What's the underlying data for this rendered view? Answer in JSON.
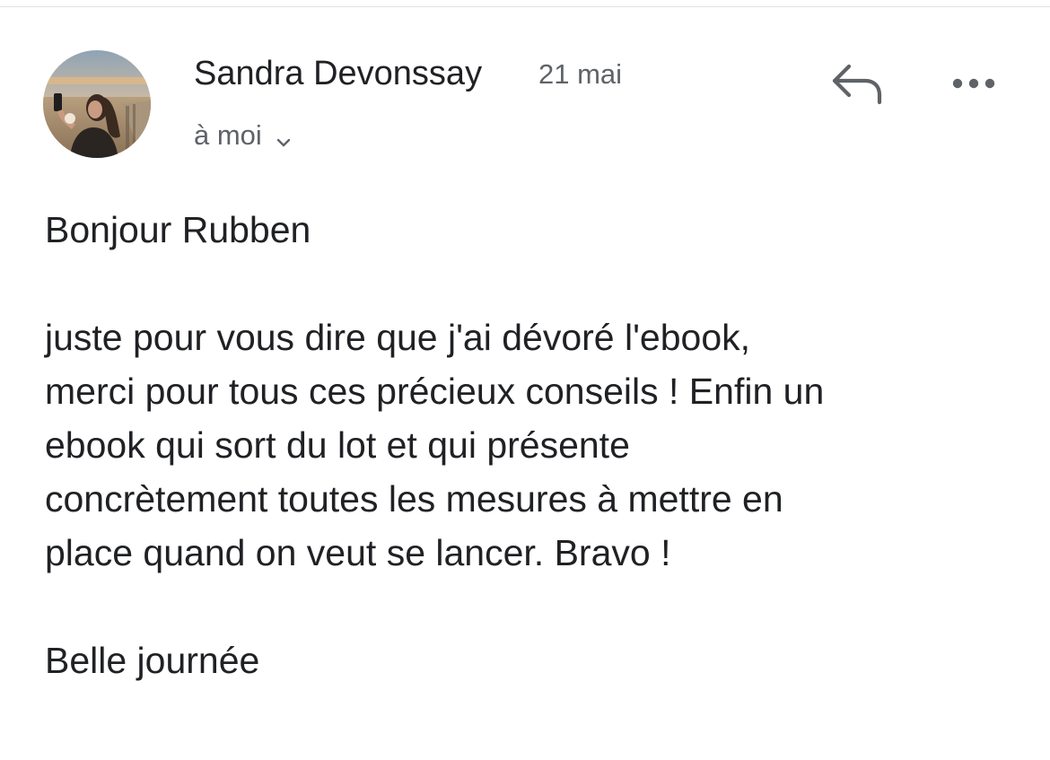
{
  "email": {
    "sender_name": "Sandra Devonssay",
    "date": "21 mai",
    "recipient": "à moi",
    "avatar_icon": "profile-photo",
    "reply_icon": "reply-arrow-icon",
    "more_icon": "more-horizontal-icon",
    "expand_icon": "chevron-down-icon"
  },
  "message": {
    "greeting": "Bonjour Rubben",
    "lines": [
      "juste pour vous dire que j'ai dévoré l'ebook,",
      "merci pour tous ces précieux conseils ! Enfin un",
      "ebook qui sort du lot et qui présente",
      "concrètement toutes les mesures à mettre en",
      "place quand on veut se lancer. Bravo !"
    ],
    "closing": "Belle journée"
  },
  "colors": {
    "text_primary": "#202124",
    "text_secondary": "#5f6368",
    "icon": "#5f6368"
  }
}
